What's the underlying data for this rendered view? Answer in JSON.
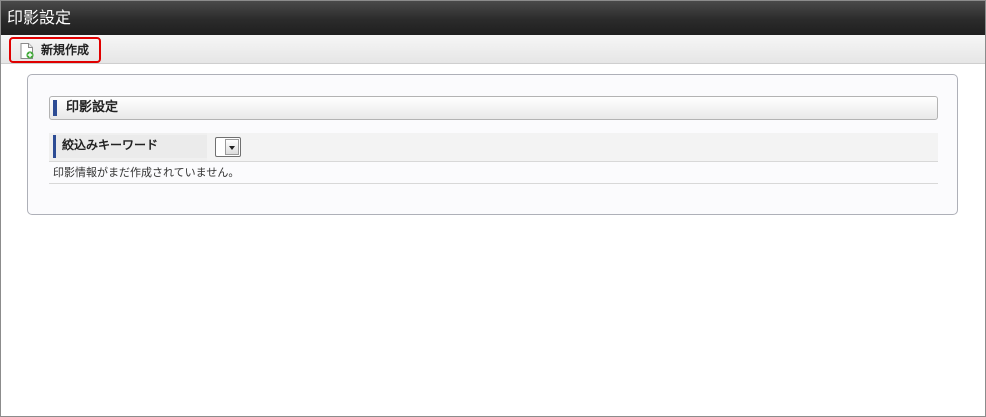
{
  "window": {
    "title": "印影設定"
  },
  "toolbar": {
    "new_button": {
      "label": "新規作成",
      "icon": "new-document-icon"
    }
  },
  "section": {
    "title": "印影設定",
    "filter": {
      "label": "絞込みキーワード",
      "selected_value": ""
    },
    "empty_message": "印影情報がまだ作成されていません。"
  },
  "colors": {
    "titlebar": "#2b2b2b",
    "accent_bar": "#2d4c94",
    "highlight_border": "#e00000"
  }
}
